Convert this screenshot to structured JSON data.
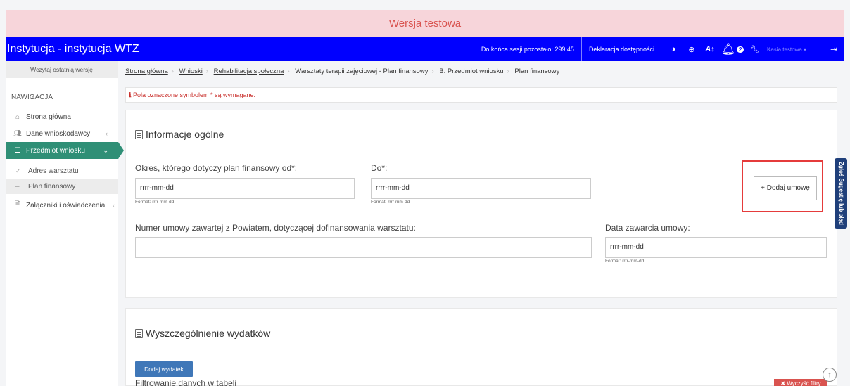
{
  "banner": {
    "text": "Wersja testowa"
  },
  "topbar": {
    "title": "Instytucja - instytucja WTZ",
    "session_text": "Do końca sesji pozostało: 299:45",
    "declaration": "Deklaracja dostępności",
    "notification_count": "2",
    "user_name": "Kasia testowa ▾",
    "icons": [
      "contrast-icon",
      "zoom-icon",
      "font-size-icon",
      "bell-icon",
      "wrench-icon",
      "logout-icon"
    ]
  },
  "sidebar": {
    "load_version": "Wczytaj ostatnią wersję",
    "heading": "NAWIGACJA",
    "items": [
      {
        "label": "Strona główna",
        "icon": "home-icon"
      },
      {
        "label": "Dane wnioskodawcy",
        "icon": "users-icon"
      },
      {
        "label": "Przedmiot wniosku",
        "icon": "list-icon"
      },
      {
        "label": "Załączniki i oświadczenia",
        "icon": "file-icon"
      }
    ],
    "sub_items": [
      {
        "label": "Adres warsztatu",
        "icon": "check-icon"
      },
      {
        "label": "Plan finansowy",
        "icon": "dash-icon"
      }
    ]
  },
  "breadcrumb": [
    "Strona główna",
    "Wnioski",
    "Rehabilitacja społeczna",
    "Warsztaty terapii zajęciowej - Plan finansowy",
    "B. Przedmiot wniosku",
    "Plan finansowy"
  ],
  "required_note": "Pola oznaczone symbolem * są wymagane.",
  "general_info": {
    "title": "Informacje ogólne",
    "period_from_label": "Okres, którego dotyczy plan finansowy od*:",
    "period_from_value": "rrrr-mm-dd",
    "period_to_label": "Do*:",
    "period_to_value": "rrrr-mm-dd",
    "format_hint": "Format: rrrr-mm-dd",
    "add_contract_button": "+ Dodaj umowę",
    "contract_number_label": "Numer umowy zawartej z Powiatem, dotyczącej dofinansowania warsztatu:",
    "contract_number_value": "",
    "contract_date_label": "Data zawarcia umowy:",
    "contract_date_value": "rrrr-mm-dd"
  },
  "side_tab": "Zgłoś Sugestię lub błąd",
  "expenses": {
    "title": "Wyszczególnienie wydatków",
    "add_button": "Dodaj wydatek",
    "filter_title": "Filtrowanie danych w tabeli",
    "clear_filters": "✖ Wyczyść filtry"
  },
  "colors": {
    "banner_bg": "#f7d5da",
    "banner_text": "#d9534f",
    "topbar_bg": "#0000ff",
    "active_nav": "#2f8f76",
    "primary_button": "#3f77b8",
    "highlight": "#e53b3b"
  }
}
